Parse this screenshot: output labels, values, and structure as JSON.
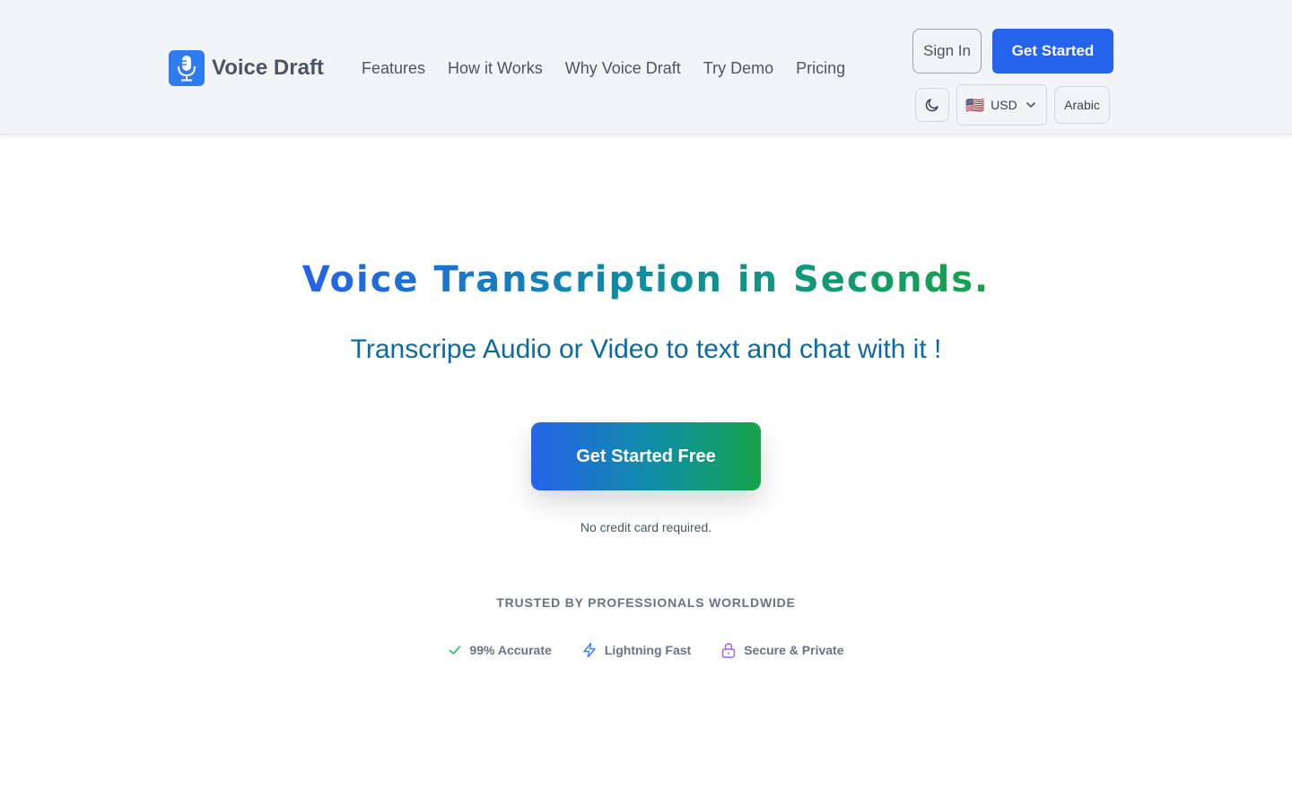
{
  "brand": {
    "name": "Voice Draft",
    "logo_icon": "microphone-icon",
    "color": "#2f7cf0"
  },
  "nav": {
    "items": [
      {
        "label": "Features"
      },
      {
        "label": "How it Works"
      },
      {
        "label": "Why Voice Draft"
      },
      {
        "label": "Try Demo"
      },
      {
        "label": "Pricing"
      }
    ]
  },
  "header_actions": {
    "sign_in": "Sign In",
    "get_started": "Get Started",
    "theme_icon": "moon-icon",
    "currency": {
      "flag": "🇺🇸",
      "selected": "USD"
    },
    "language": "Arabic"
  },
  "hero": {
    "title": "Voice Transcription in Seconds.",
    "subtitle": "Transcripe Audio or Video to text and chat with it !",
    "cta": "Get Started Free",
    "cta_note": "No credit card required.",
    "trusted": "TRUSTED BY PROFESSIONALS WORLDWIDE",
    "badges": [
      {
        "label": "99% Accurate",
        "icon": "check-icon",
        "color": "#22c55e"
      },
      {
        "label": "Lightning Fast",
        "icon": "lightning-icon",
        "color": "#3b82f6"
      },
      {
        "label": "Secure & Private",
        "icon": "lock-icon",
        "color": "#a855f7"
      }
    ]
  },
  "colors": {
    "primary": "#2563eb",
    "accent_green": "#16a34a",
    "header_bg": "#f3f4f6",
    "subtitle": "#0c6a9e"
  }
}
